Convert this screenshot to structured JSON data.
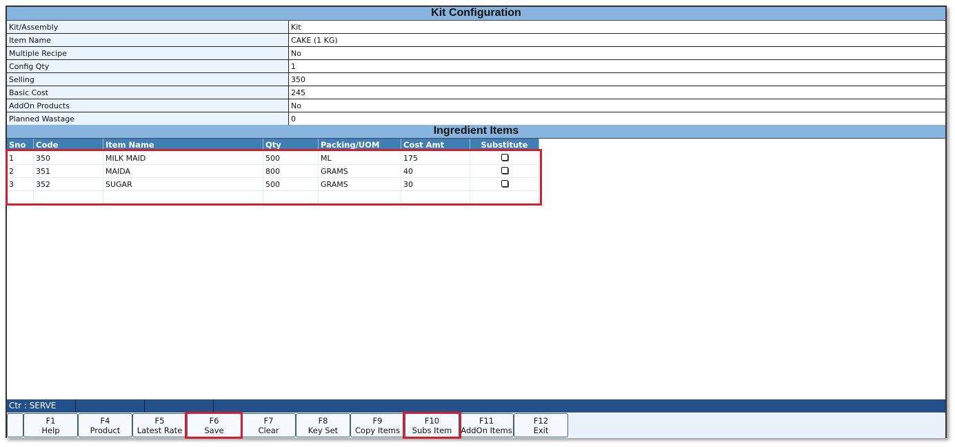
{
  "title": "Kit Configuration",
  "config": [
    {
      "label": "Kit/Assembly",
      "value": "Kit"
    },
    {
      "label": "Item Name",
      "value": "CAKE (1 KG)"
    },
    {
      "label": "Multiple Recipe",
      "value": "No"
    },
    {
      "label": "Config Qty",
      "value": "1"
    },
    {
      "label": "Selling",
      "value": "350"
    },
    {
      "label": "Basic Cost",
      "value": "245"
    },
    {
      "label": "AddOn Products",
      "value": "No"
    },
    {
      "label": "Planned Wastage",
      "value": "0"
    }
  ],
  "ingredients": {
    "title": "Ingredient Items",
    "columns": [
      "Sno",
      "Code",
      "Item Name",
      "Qty",
      "Packing/UOM",
      "Cost Amt",
      "Substitute"
    ],
    "rows": [
      [
        "1",
        "350",
        "MILK MAID",
        "500",
        "ML",
        "175"
      ],
      [
        "2",
        "351",
        "MAIDA",
        "800",
        "GRAMS",
        "40"
      ],
      [
        "3",
        "352",
        "SUGAR",
        "500",
        "GRAMS",
        "30"
      ]
    ]
  },
  "status": {
    "counter": "Ctr : SERVE"
  },
  "buttons": [
    {
      "key": "F1",
      "label": "Help"
    },
    {
      "key": "F4",
      "label": "Product"
    },
    {
      "key": "F5",
      "label": "Latest Rate"
    },
    {
      "key": "F6",
      "label": "Save"
    },
    {
      "key": "F7",
      "label": "Clear"
    },
    {
      "key": "F8",
      "label": "Key Set"
    },
    {
      "key": "F9",
      "label": "Copy Items"
    },
    {
      "key": "F10",
      "label": "Subs Item"
    },
    {
      "key": "F11",
      "label": "AddOn Items"
    },
    {
      "key": "F12",
      "label": "Exit"
    }
  ]
}
